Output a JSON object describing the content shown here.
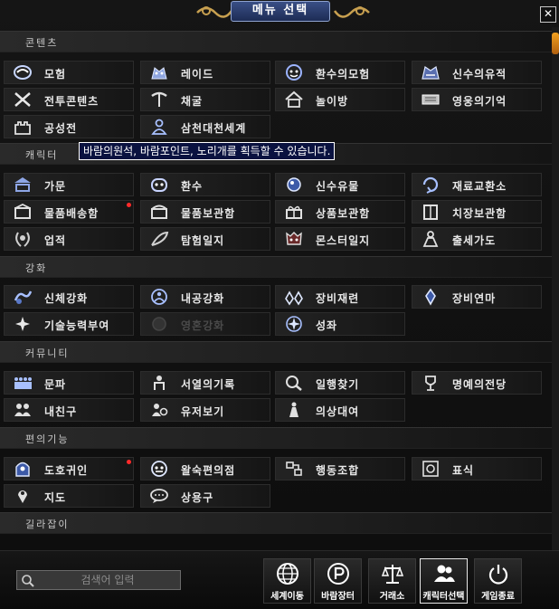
{
  "window": {
    "title": "메뉴 선택",
    "close_symbol": "✕"
  },
  "sections": {
    "content": "콘텐츠",
    "character": "캐릭터",
    "enhance": "강화",
    "community": "커뮤니티",
    "convenience": "편의기능",
    "guild": "길라잡이"
  },
  "items": {
    "adventure": "모험",
    "raid": "레이드",
    "summon_adventure": "환수의모험",
    "relic": "신수의유적",
    "battle_content": "전투콘텐츠",
    "mining": "채굴",
    "playroom": "놀이방",
    "hero_memory": "영웅의기억",
    "siege": "공성전",
    "three_heavens": "삼천대천세계",
    "clan": "가문",
    "summon": "환수",
    "divine_relic": "신수유물",
    "material_exchange": "재료교환소",
    "item_delivery": "물품배송함",
    "item_storage": "물품보관함",
    "goods_storage": "상품보관함",
    "stage_storage": "치장보관함",
    "achievement": "업적",
    "exploration_diary": "탐험일지",
    "monster_diary": "몬스터일지",
    "career_path": "출세가도",
    "body_enhance": "신체강화",
    "inner_enhance": "내공강화",
    "equipment_refine": "장비재련",
    "equipment_polish": "장비연마",
    "skill_grant": "기술능력부여",
    "soul_enhance": "영혼강화",
    "constellation": "성좌",
    "clan_group": "문파",
    "western_record": "서열의기록",
    "party_finder": "일행찾기",
    "hall_of_fame": "명예의전당",
    "friends": "내친구",
    "remains_view": "유저보기",
    "costume_rental": "의상대여",
    "dohoguiin": "도호귀인",
    "convenience_store": "왈숙편의점",
    "action_combo": "행동조합",
    "marker": "표식",
    "map": "지도",
    "chat_phrase": "상용구"
  },
  "tooltip": "바람의원석, 바람포인트, 노리개를 획득할 수 있습니다.",
  "search": {
    "placeholder": "검색어 입력"
  },
  "bottom_buttons": {
    "world_move": "세계이동",
    "wind_market": "바람장터",
    "exchange": "거래소",
    "char_select": "캐릭터선택",
    "quit": "게임종료"
  },
  "colors": {
    "accent": "#3a4f86",
    "notify_dot": "#ff2a2a",
    "tooltip_bg": "#0a1240"
  }
}
